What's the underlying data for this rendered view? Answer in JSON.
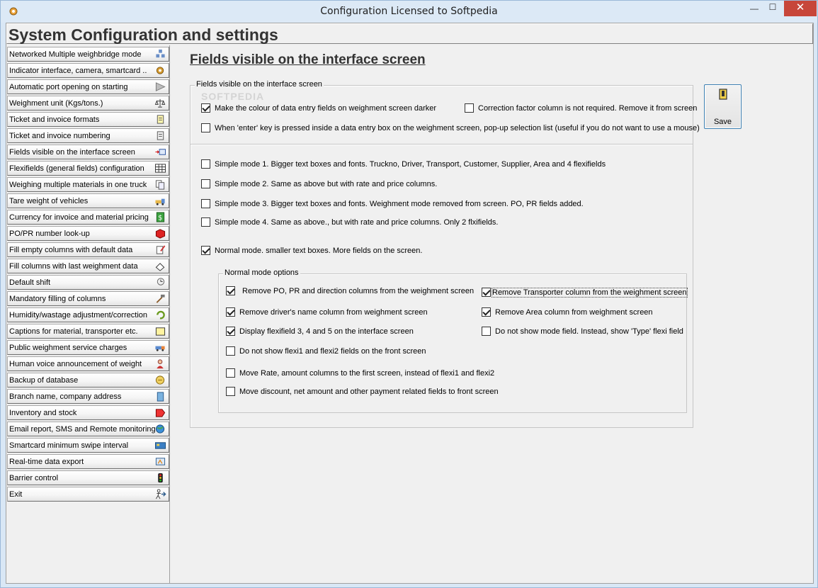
{
  "window": {
    "title": "Configuration  Licensed to Softpedia",
    "min_glyph": "—",
    "max_glyph": "☐",
    "close_glyph": "✕"
  },
  "header": {
    "title": "System Configuration and settings"
  },
  "sidebar": {
    "items": [
      {
        "label": "Networked Multiple weighbridge mode",
        "icon": "network-icon"
      },
      {
        "label": "Indicator interface, camera, smartcard ..",
        "icon": "gear-icon"
      },
      {
        "label": "Automatic port opening on starting",
        "icon": "gate-icon"
      },
      {
        "label": "Weighment unit (Kgs/tons.)",
        "icon": "scale-icon"
      },
      {
        "label": "Ticket and invoice formats",
        "icon": "document-icon"
      },
      {
        "label": "Ticket and invoice numbering",
        "icon": "numbered-document-icon"
      },
      {
        "label": "Fields visible on the interface screen",
        "icon": "arrow-window-icon"
      },
      {
        "label": "Flexifields (general fields) configuration",
        "icon": "grid-icon"
      },
      {
        "label": "Weighing multiple materials in one truck",
        "icon": "copy-icon"
      },
      {
        "label": "Tare weight of vehicles",
        "icon": "truck-icon"
      },
      {
        "label": "Currency for invoice and material pricing",
        "icon": "dollar-icon"
      },
      {
        "label": "PO/PR number look-up",
        "icon": "book-icon"
      },
      {
        "label": "Fill empty columns with default data",
        "icon": "edit-icon"
      },
      {
        "label": "Fill columns with last weighment data",
        "icon": "eraser-icon"
      },
      {
        "label": "Default shift",
        "icon": "clock-icon"
      },
      {
        "label": "Mandatory filling of columns",
        "icon": "hammer-icon"
      },
      {
        "label": "Humidity/wastage adjustment/correction",
        "icon": "refresh-icon"
      },
      {
        "label": "Captions for material, transporter etc.",
        "icon": "caption-icon"
      },
      {
        "label": "Public weighment service charges",
        "icon": "service-truck-icon"
      },
      {
        "label": "Human voice announcement of weight",
        "icon": "person-icon"
      },
      {
        "label": "Backup of database",
        "icon": "backup-icon"
      },
      {
        "label": "Branch name, company address",
        "icon": "building-icon"
      },
      {
        "label": "Inventory and stock",
        "icon": "inventory-icon"
      },
      {
        "label": "Email report, SMS and Remote monitoring",
        "icon": "globe-icon"
      },
      {
        "label": "Smartcard minimum swipe interval",
        "icon": "card-icon"
      },
      {
        "label": "Real-time data export",
        "icon": "export-icon"
      },
      {
        "label": "Barrier control",
        "icon": "traffic-light-icon"
      },
      {
        "label": "Exit",
        "icon": "exit-icon"
      }
    ]
  },
  "main": {
    "title": "Fields visible on the interface screen",
    "group1": {
      "legend": "Fields visible on the interface screen",
      "options": [
        {
          "label": "Make the colour of data entry fields on weighment screen darker",
          "checked": true
        },
        {
          "label": "Correction factor column is not required. Remove it from screen",
          "checked": false
        },
        {
          "label": "When 'enter' key is pressed inside a data entry box on the weighment screen, pop-up selection list (useful if you do not want to use a mouse)",
          "checked": false
        }
      ]
    },
    "modes": [
      {
        "label": "Simple mode 1. Bigger text boxes and fonts. Truckno, Driver, Transport, Customer, Supplier, Area and 4 flexifields",
        "checked": false
      },
      {
        "label": "Simple mode 2. Same as above but with rate and price columns.",
        "checked": false
      },
      {
        "label": "Simple mode 3. Bigger text boxes and fonts. Weighment mode removed from screen. PO, PR  fields added.",
        "checked": false
      },
      {
        "label": "Simple mode 4. Same as above., but with rate and price columns. Only 2 flxifields.",
        "checked": false
      },
      {
        "label": "Normal mode. smaller text boxes. More fields on the screen.",
        "checked": true
      }
    ],
    "normal_options": {
      "legend": "Normal mode options",
      "options": [
        {
          "label": "Remove PO, PR and direction columns from the weighment screen",
          "checked": true
        },
        {
          "label": "Remove Transporter column from the weighment screen",
          "checked": true
        },
        {
          "label": "Remove driver's name column from weighment screen",
          "checked": true
        },
        {
          "label": "Remove Area column from weighment screen",
          "checked": true
        },
        {
          "label": "Display flexifield 3, 4 and 5 on the interface screen",
          "checked": true
        },
        {
          "label": "Do not show mode field. Instead, show 'Type' flexi field",
          "checked": false
        },
        {
          "label": "Do not show flexi1 and flexi2 fields on the front screen",
          "checked": false
        },
        {
          "label": "Move Rate, amount columns to the first screen, instead of flexi1 and flexi2",
          "checked": false
        },
        {
          "label": "Move discount, net amount and other payment related fields to front screen",
          "checked": false
        }
      ]
    },
    "save_label": "Save",
    "watermark": "SOFTPEDIA"
  }
}
